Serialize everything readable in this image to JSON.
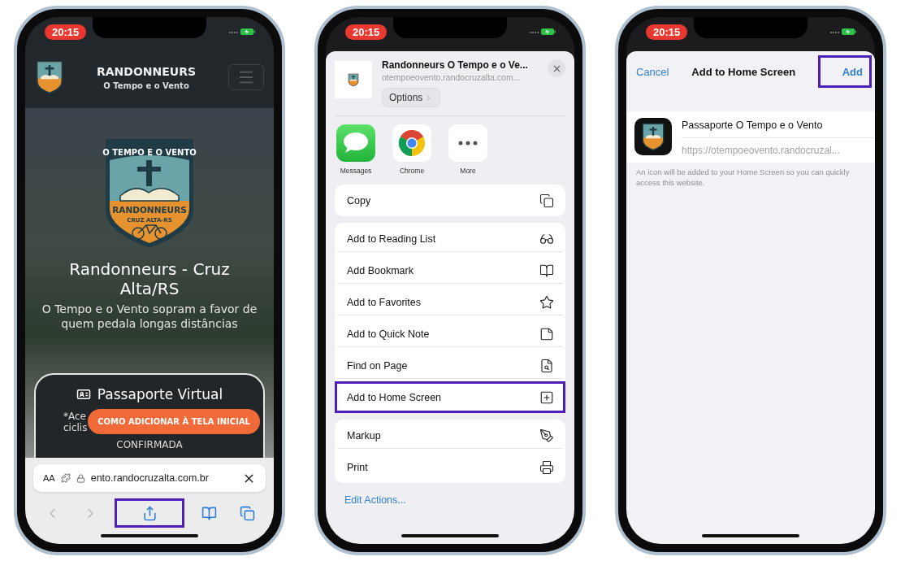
{
  "browser_screen": {
    "status_time": "20:15",
    "header": {
      "title": "RANDONNEURS",
      "subtitle": "O Tempo e o Vento"
    },
    "badge": {
      "top_text": "O TEMPO E O VENTO",
      "main_text": "RANDONNEURS",
      "bottom_text": "CRUZ ALTA-RS"
    },
    "hero": {
      "title": "Randonneurs - Cruz Alta/RS",
      "subtitle": "O Tempo e o Vento sopram a favor de quem pedala longas distâncias"
    },
    "card": {
      "title": "Passaporte Virtual",
      "lines": [
        "*Ace",
        "ciclis"
      ],
      "status": "CONFIRMADA"
    },
    "cta": "COMO ADICIONAR À TELA INICIAL",
    "address_bar": {
      "text_size": "AA",
      "url": "ento.randocruzalta.com.br"
    },
    "toolbar": [
      {
        "kind": "back",
        "highlighted": false
      },
      {
        "kind": "forward",
        "highlighted": false
      },
      {
        "kind": "share",
        "highlighted": true
      },
      {
        "kind": "bookmarks",
        "highlighted": false
      },
      {
        "kind": "tabs",
        "highlighted": false
      }
    ]
  },
  "share_sheet": {
    "status_time": "20:15",
    "header": {
      "title": "Randonneurs O Tempo e o Ve...",
      "url": "otempoeovento.randocruzalta.com...",
      "options": "Options"
    },
    "apps": [
      {
        "kind": "messages",
        "label": "Messages"
      },
      {
        "kind": "chrome",
        "label": "Chrome"
      },
      {
        "kind": "more",
        "label": "More"
      }
    ],
    "groups": [
      [
        {
          "label": "Copy",
          "kind": "copy",
          "highlighted": false
        }
      ],
      [
        {
          "label": "Add to Reading List",
          "kind": "glasses",
          "highlighted": false
        },
        {
          "label": "Add Bookmark",
          "kind": "book",
          "highlighted": false
        },
        {
          "label": "Add to Favorites",
          "kind": "star",
          "highlighted": false
        },
        {
          "label": "Add to Quick Note",
          "kind": "note",
          "highlighted": false
        },
        {
          "label": "Find on Page",
          "kind": "find",
          "highlighted": false
        },
        {
          "label": "Add to Home Screen",
          "kind": "add",
          "highlighted": true
        }
      ],
      [
        {
          "label": "Markup",
          "kind": "markup",
          "highlighted": false
        },
        {
          "label": "Print",
          "kind": "print",
          "highlighted": false
        }
      ]
    ],
    "edit_actions": "Edit Actions..."
  },
  "add_screen": {
    "status_time": "20:15",
    "nav": {
      "cancel": "Cancel",
      "title": "Add to Home Screen",
      "add": "Add",
      "add_highlighted": true
    },
    "app_name": "Passaporte O Tempo e o Vento",
    "url": "https://otempoeovento.randocruzal...",
    "note": "An icon will be added to your Home Screen so you can quickly access this website."
  }
}
